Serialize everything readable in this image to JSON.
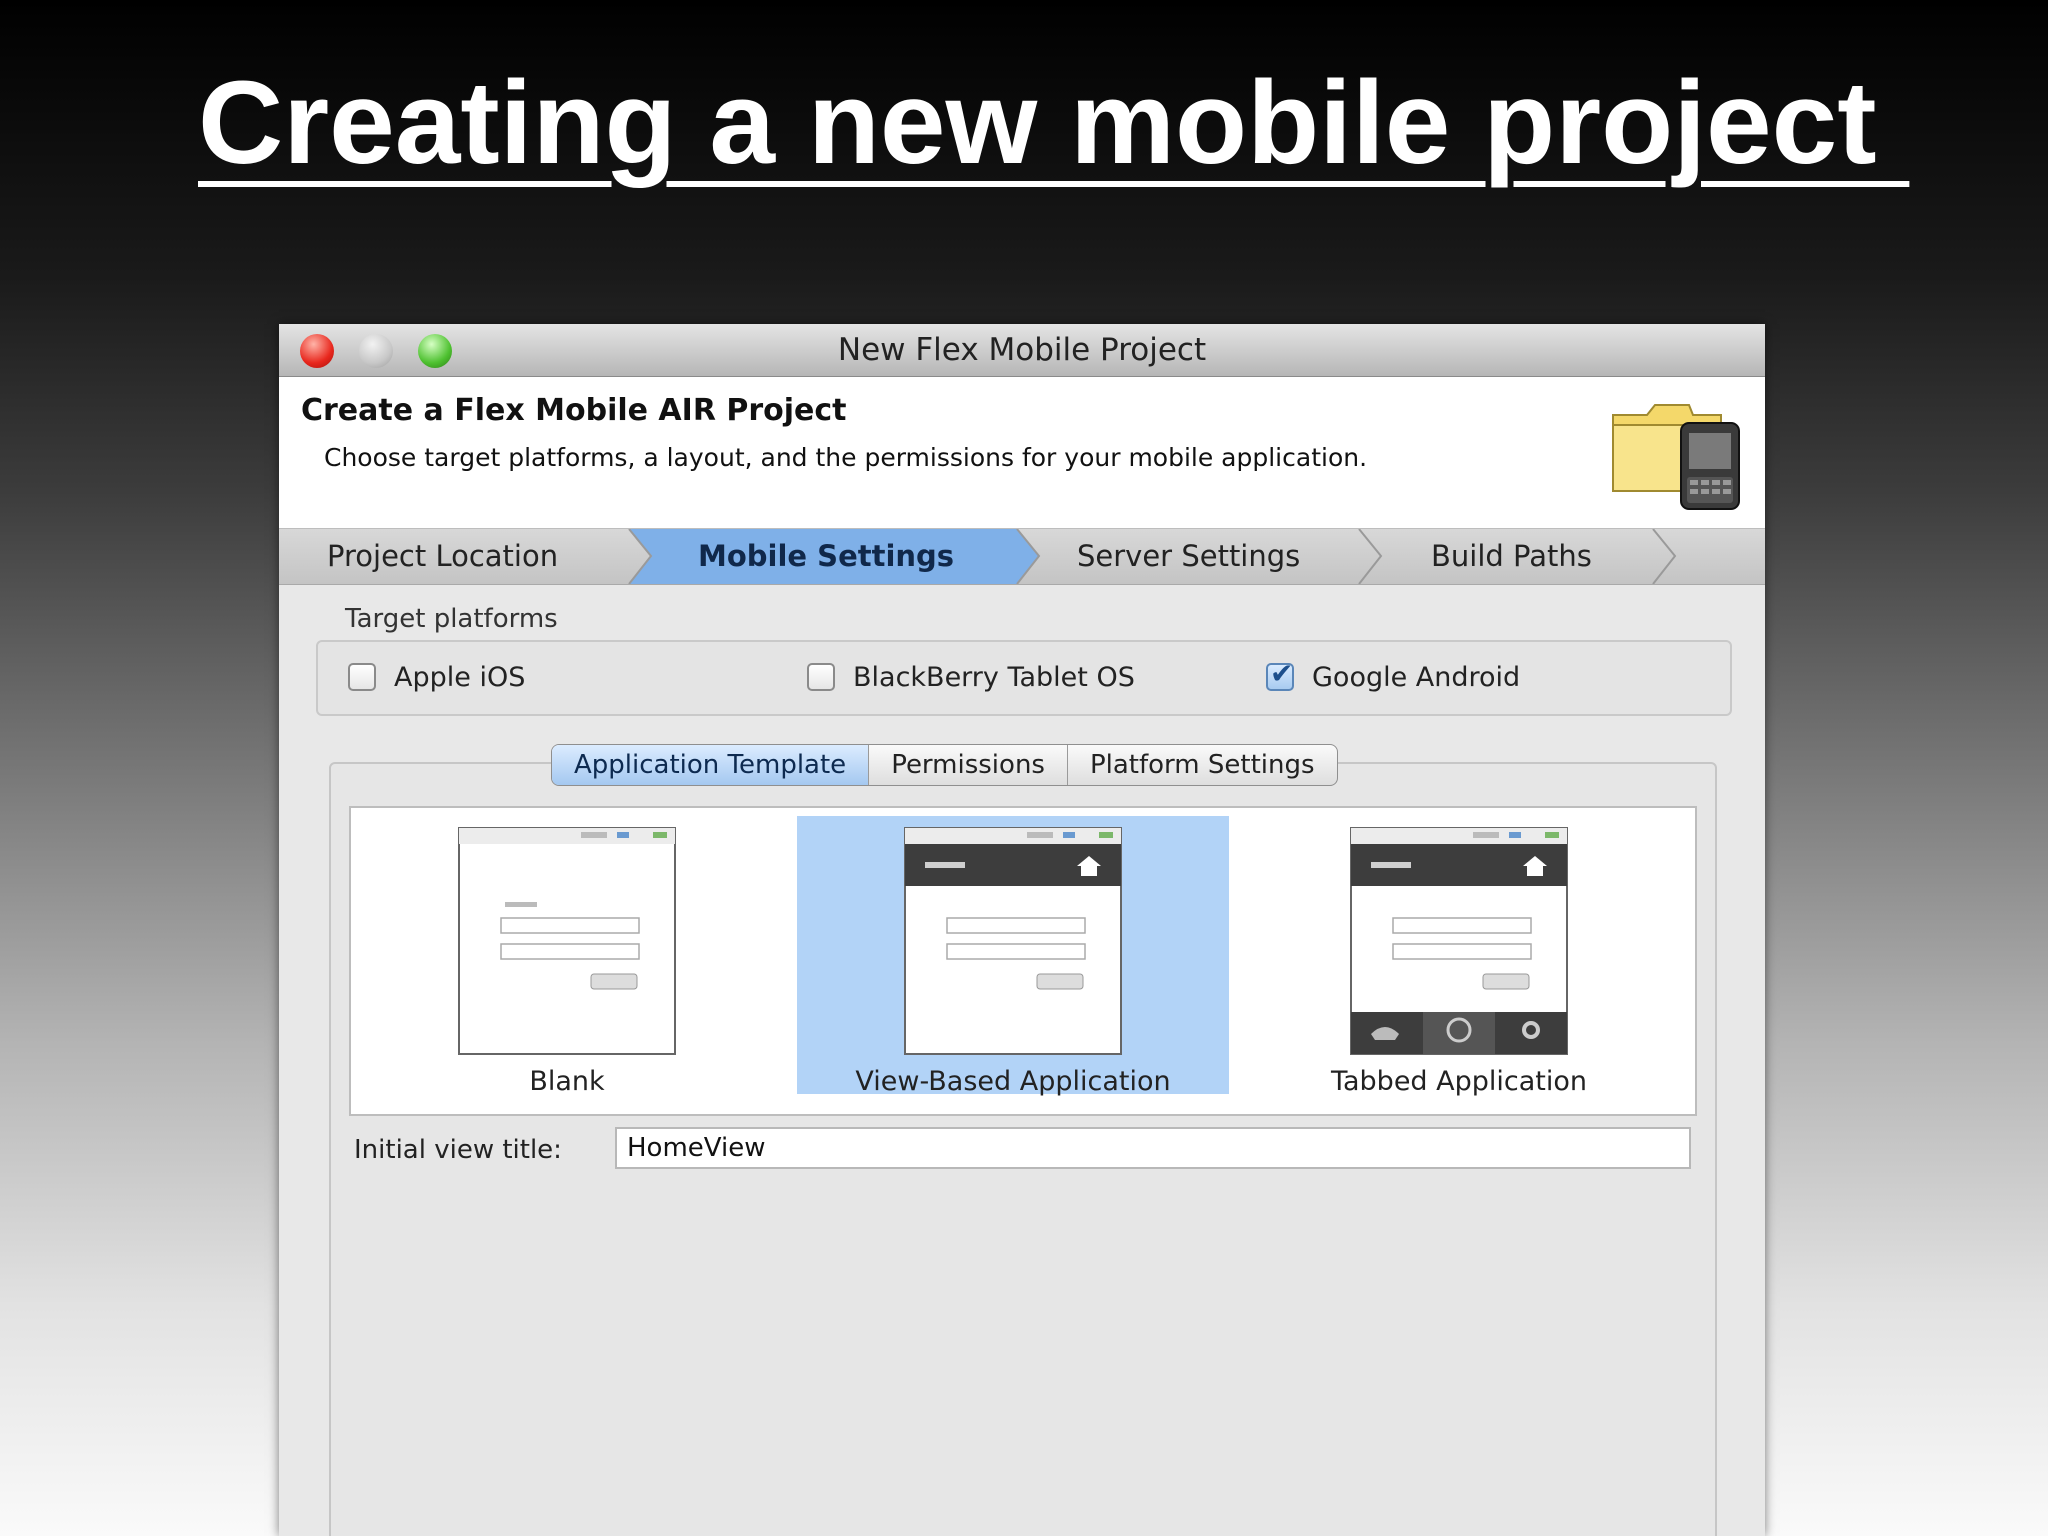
{
  "slide": {
    "title": "Creating a new mobile project "
  },
  "window": {
    "title": "New Flex Mobile Project"
  },
  "header": {
    "heading": "Create a Flex Mobile AIR Project",
    "description": "Choose target platforms, a layout, and the permissions for your mobile application.",
    "icon": "folder-with-phone-icon"
  },
  "wizard_steps": [
    {
      "label": "Project Location",
      "active": false
    },
    {
      "label": "Mobile Settings",
      "active": true
    },
    {
      "label": "Server Settings",
      "active": false
    },
    {
      "label": "Build Paths",
      "active": false
    }
  ],
  "platforms": {
    "label": "Target platforms",
    "options": [
      {
        "label": "Apple iOS",
        "checked": false
      },
      {
        "label": "BlackBerry Tablet OS",
        "checked": false
      },
      {
        "label": "Google Android",
        "checked": true
      }
    ]
  },
  "tabs": [
    {
      "label": "Application Template",
      "active": true
    },
    {
      "label": "Permissions",
      "active": false
    },
    {
      "label": "Platform Settings",
      "active": false
    }
  ],
  "templates": [
    {
      "label": "Blank",
      "selected": false
    },
    {
      "label": "View-Based Application",
      "selected": true
    },
    {
      "label": "Tabbed Application",
      "selected": false
    }
  ],
  "initial_view": {
    "label": "Initial view title:",
    "value": "HomeView"
  },
  "colors": {
    "selection": "#b2d3f7",
    "active_step": "#7fb0e8",
    "close": "#e8271d",
    "zoom": "#4ec130"
  }
}
